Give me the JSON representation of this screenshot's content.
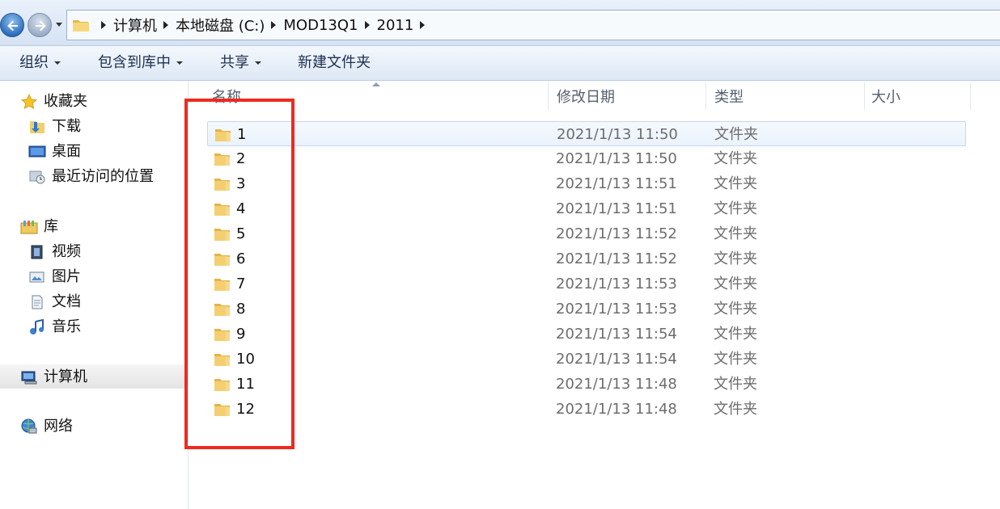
{
  "address": {
    "crumbs": [
      "计算机",
      "本地磁盘 (C:)",
      "MOD13Q1",
      "2011"
    ]
  },
  "toolbar": {
    "organize": "组织",
    "include_in_library": "包含到库中",
    "share": "共享",
    "new_folder": "新建文件夹"
  },
  "navpane": {
    "favorites": "收藏夹",
    "downloads": "下载",
    "desktop": "桌面",
    "recent": "最近访问的位置",
    "libraries": "库",
    "videos": "视频",
    "pictures": "图片",
    "documents": "文档",
    "music": "音乐",
    "computer": "计算机",
    "network": "网络"
  },
  "columns": {
    "name": "名称",
    "modified": "修改日期",
    "type": "类型",
    "size": "大小"
  },
  "rows": [
    {
      "name": "1",
      "date": "2021/1/13 11:50",
      "type": "文件夹"
    },
    {
      "name": "2",
      "date": "2021/1/13 11:50",
      "type": "文件夹"
    },
    {
      "name": "3",
      "date": "2021/1/13 11:51",
      "type": "文件夹"
    },
    {
      "name": "4",
      "date": "2021/1/13 11:51",
      "type": "文件夹"
    },
    {
      "name": "5",
      "date": "2021/1/13 11:52",
      "type": "文件夹"
    },
    {
      "name": "6",
      "date": "2021/1/13 11:52",
      "type": "文件夹"
    },
    {
      "name": "7",
      "date": "2021/1/13 11:53",
      "type": "文件夹"
    },
    {
      "name": "8",
      "date": "2021/1/13 11:53",
      "type": "文件夹"
    },
    {
      "name": "9",
      "date": "2021/1/13 11:54",
      "type": "文件夹"
    },
    {
      "name": "10",
      "date": "2021/1/13 11:54",
      "type": "文件夹"
    },
    {
      "name": "11",
      "date": "2021/1/13 11:48",
      "type": "文件夹"
    },
    {
      "name": "12",
      "date": "2021/1/13 11:48",
      "type": "文件夹"
    }
  ],
  "colors": {
    "highlight_box": "#ef2a1e"
  }
}
